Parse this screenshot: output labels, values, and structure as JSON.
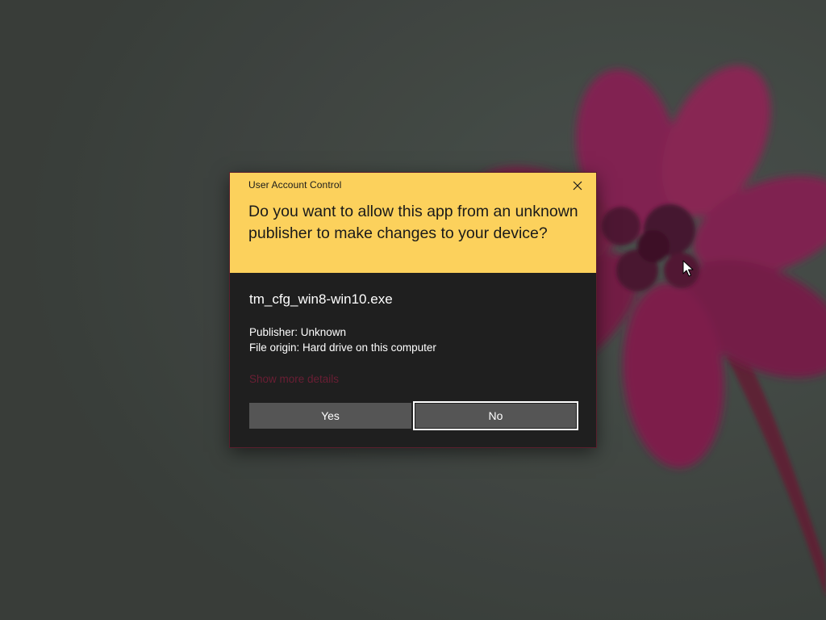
{
  "dialog": {
    "title": "User Account Control",
    "question": "Do you want to allow this app from an unknown publisher to make changes to your device?",
    "file_name": "tm_cfg_win8-win10.exe",
    "publisher": "Publisher: Unknown",
    "file_origin": "File origin: Hard drive on this computer",
    "details_link": "Show more details",
    "yes_label": "Yes",
    "no_label": "No",
    "close_icon": "close-icon"
  },
  "colors": {
    "header_background": "#fcd15c",
    "body_background": "#1f1f1f",
    "button_background": "#555555",
    "focus_border": "#ffffff",
    "details_link": "#6a1f34",
    "desktop_background": "#3f4440",
    "flower": "#8a1f4d"
  },
  "wallpaper": {
    "subject": "pink-flower"
  },
  "cursor": {
    "icon": "arrow-cursor-icon"
  }
}
